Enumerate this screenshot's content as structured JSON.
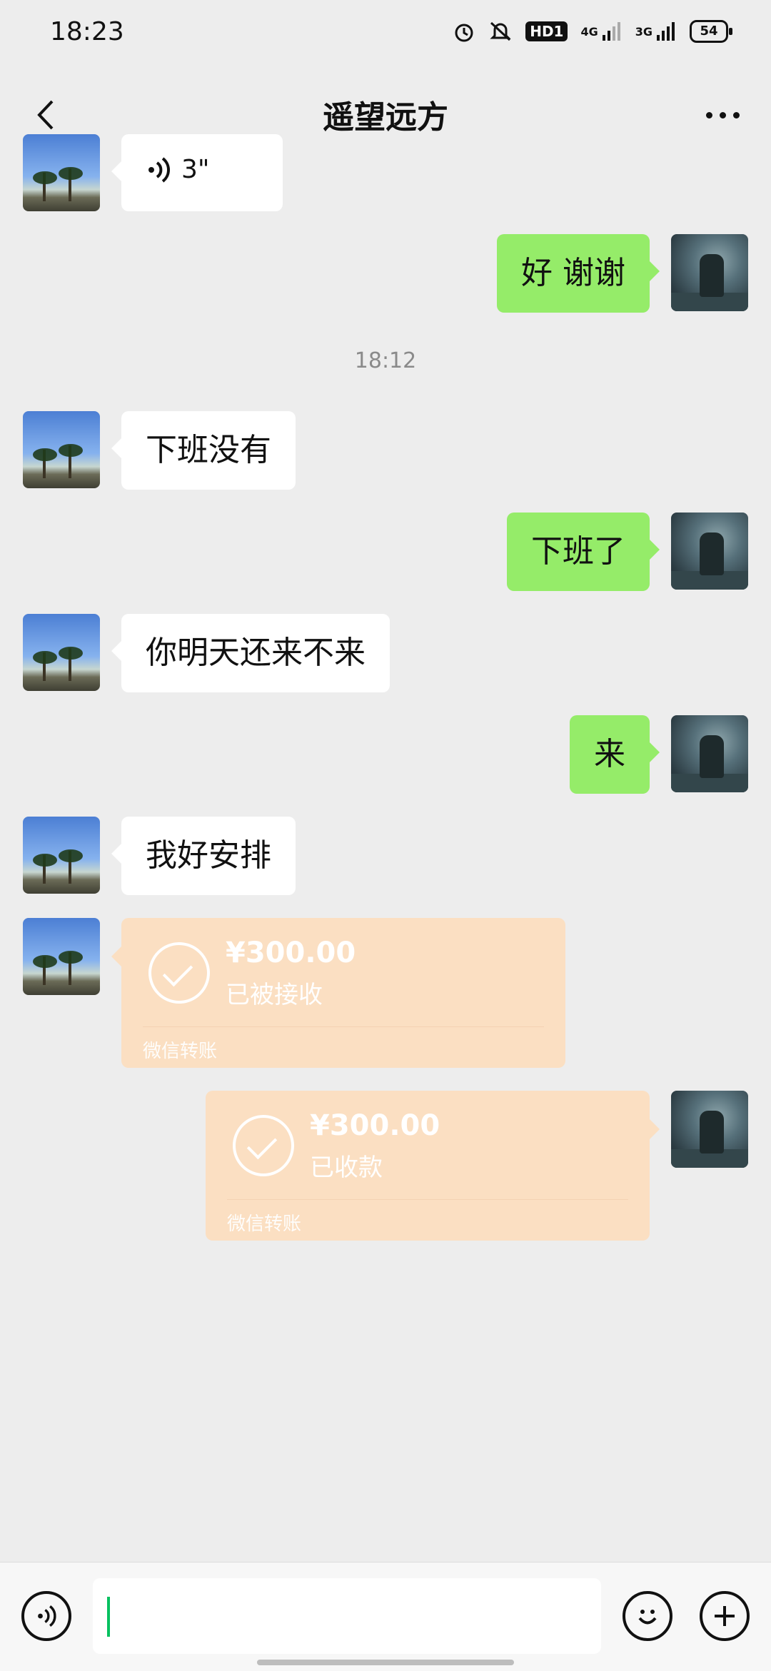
{
  "status_bar": {
    "time": "18:23",
    "hd_label": "HD1",
    "net1": "4G",
    "net2": "3G",
    "battery": "54"
  },
  "header": {
    "title": "遥望远方"
  },
  "chat": {
    "top_voice": {
      "duration": "3\""
    },
    "msg_out_1": "好 谢谢",
    "timestamp": "18:12",
    "msg_in_1": "下班没有",
    "msg_out_2": "下班了",
    "msg_in_2": "你明天还来不来",
    "msg_out_3": "来",
    "msg_in_3": "我好安排",
    "transfer_in": {
      "amount": "¥300.00",
      "status": "已被接收",
      "footer": "微信转账"
    },
    "transfer_out": {
      "amount": "¥300.00",
      "status": "已收款",
      "footer": "微信转账"
    }
  },
  "colors": {
    "outgoing_bubble": "#95ec69",
    "incoming_bubble": "#ffffff",
    "transfer_card": "#fbdfc2",
    "background": "#ededed"
  },
  "icons": [
    "back-chevron-icon",
    "more-dots-icon",
    "voice-icon",
    "emoji-icon",
    "plus-icon"
  ]
}
